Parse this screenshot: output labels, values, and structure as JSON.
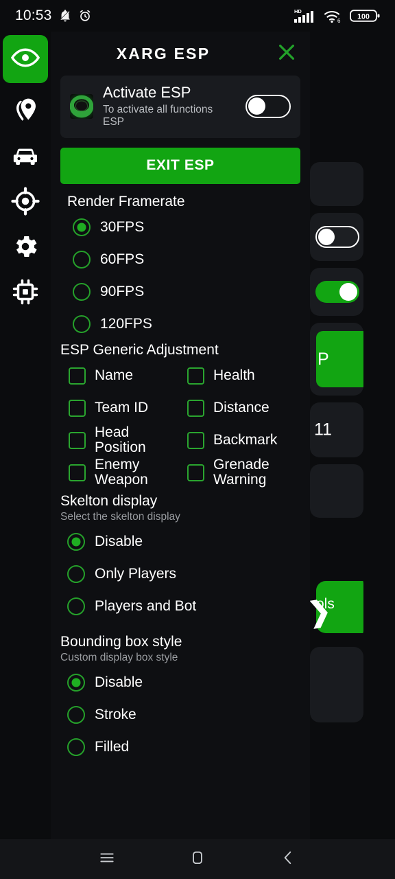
{
  "status_bar": {
    "time": "10:53",
    "icons_left": [
      "mute-icon",
      "alarm-icon"
    ],
    "network_label": "HD",
    "wifi_label": "6",
    "battery_level": "100"
  },
  "rail": {
    "eye_icon": "eye-icon",
    "items": [
      {
        "icon": "location-pin-icon",
        "name": "location"
      },
      {
        "icon": "car-icon",
        "name": "vehicle"
      },
      {
        "icon": "crosshair-icon",
        "name": "aim"
      },
      {
        "icon": "gear-icon",
        "name": "settings"
      },
      {
        "icon": "chip-icon",
        "name": "memory"
      }
    ]
  },
  "panel": {
    "title": "XARG ESP",
    "close_icon": "close-icon",
    "activate": {
      "logo": "app-logo-icon",
      "title": "Activate ESP",
      "subtitle": "To activate all functions ESP",
      "toggle_state": "off"
    },
    "exit_button": "EXIT ESP",
    "framerate": {
      "title": "Render Framerate",
      "options": [
        {
          "label": "30FPS",
          "selected": true
        },
        {
          "label": "60FPS",
          "selected": false
        },
        {
          "label": "90FPS",
          "selected": false
        },
        {
          "label": "120FPS",
          "selected": false
        }
      ]
    },
    "generic": {
      "title": "ESP Generic Adjustment",
      "options": [
        {
          "label": "Name",
          "checked": false
        },
        {
          "label": "Health",
          "checked": false
        },
        {
          "label": "Team ID",
          "checked": false
        },
        {
          "label": "Distance",
          "checked": false
        },
        {
          "label": "Head Position",
          "checked": false
        },
        {
          "label": "Backmark",
          "checked": false
        },
        {
          "label": "Enemy Weapon",
          "checked": false
        },
        {
          "label": "Grenade Warning",
          "checked": false
        }
      ]
    },
    "skelton": {
      "title": "Skelton display",
      "subtitle": "Select the skelton display",
      "options": [
        {
          "label": "Disable",
          "selected": true
        },
        {
          "label": "Only Players",
          "selected": false
        },
        {
          "label": "Players and Bot",
          "selected": false
        }
      ]
    },
    "bounding": {
      "title": "Bounding box style",
      "subtitle": "Custom display box style",
      "options": [
        {
          "label": "Disable",
          "selected": true
        },
        {
          "label": "Stroke",
          "selected": false
        },
        {
          "label": "Filled",
          "selected": false
        }
      ]
    }
  },
  "background": {
    "green_button_partial": "P",
    "text_partial": "11",
    "tools_partial": "ols"
  },
  "navbar": {
    "recents": "menu-icon",
    "home": "home-icon",
    "back": "back-icon"
  },
  "colors": {
    "accent_green": "#12a512",
    "outline_green": "#25a02a",
    "page_bg": "#0b0c0e",
    "card_bg": "#191b1f",
    "panel_bg": "#0e0f12",
    "text_primary": "#ffffff",
    "text_secondary": "#9a9da1"
  }
}
